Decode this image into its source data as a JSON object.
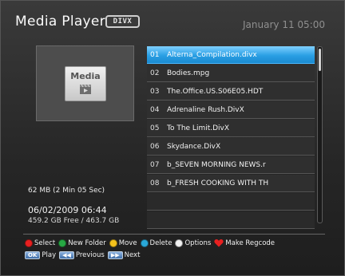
{
  "header": {
    "title": "Media Player",
    "logo_text": "DIVX",
    "datetime": "January 11 05:00"
  },
  "preview": {
    "thumb_label": "Media",
    "file_size": "62 MB (2 Min 05 Sec)",
    "file_date": "06/02/2009 06:44",
    "disk_space": "459.2 GB Free / 463.7 GB"
  },
  "file_list": {
    "items": [
      {
        "num": "01",
        "name": "Alterna_Compilation.divx",
        "selected": true
      },
      {
        "num": "02",
        "name": "Bodies.mpg"
      },
      {
        "num": "03",
        "name": "The.Office.US.S06E05.HDT"
      },
      {
        "num": "04",
        "name": "Adrenaline Rush.DivX"
      },
      {
        "num": "05",
        "name": "To The Limit.DivX"
      },
      {
        "num": "06",
        "name": "Skydance.DivX"
      },
      {
        "num": "07",
        "name": "b_SEVEN MORNING NEWS.r"
      },
      {
        "num": "08",
        "name": "b_FRESH COOKING WITH TH"
      }
    ]
  },
  "legend": {
    "select": "Select",
    "new_folder": "New Folder",
    "move": "Move",
    "delete": "Delete",
    "options": "Options",
    "make_regcode": "Make Regcode",
    "ok_key": "OK",
    "play": "Play",
    "previous": "Previous",
    "next": "Next"
  },
  "colors": {
    "red": "#e82020",
    "green": "#27a844",
    "yellow": "#f4c21c",
    "blue": "#2aa8d8",
    "white": "#f0f0f0",
    "highlight": "#2a9fe4"
  }
}
